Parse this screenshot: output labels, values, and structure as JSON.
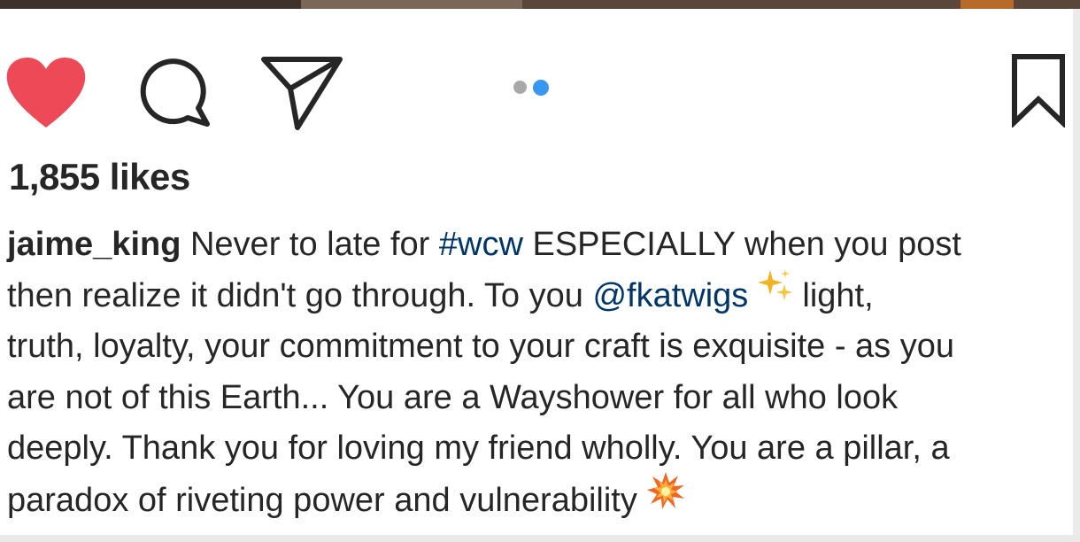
{
  "actions": {
    "like_icon": "heart-filled-icon",
    "comment_icon": "comment-bubble-icon",
    "share_icon": "paper-plane-icon",
    "save_icon": "bookmark-icon",
    "like_color": "#ed4956",
    "carousel": {
      "count": 2,
      "active_index": 2,
      "active_color": "#3897f0",
      "inactive_color": "#a8a8a8"
    }
  },
  "likes": "1,855 likes",
  "caption": {
    "username": "jaime_king",
    "line1_a": " Never to late for ",
    "hashtag": "#wcw",
    "line1_b": " ESPECIALLY when you post",
    "line2_a": "then realize it didn't go through. To you ",
    "mention": "@fkatwigs",
    "line2_emoji": "sparkles-emoji",
    "line2_b": " light,",
    "line3": "truth, loyalty, your commitment to your craft is exquisite - as you",
    "line4": "are not of this Earth... You are a Wayshower for all who look",
    "line5": "deeply. Thank you for loving my friend wholly. You are a pillar, a",
    "line6": "paradox of riveting power and vulnerability",
    "line6_emoji": "collision-emoji"
  }
}
